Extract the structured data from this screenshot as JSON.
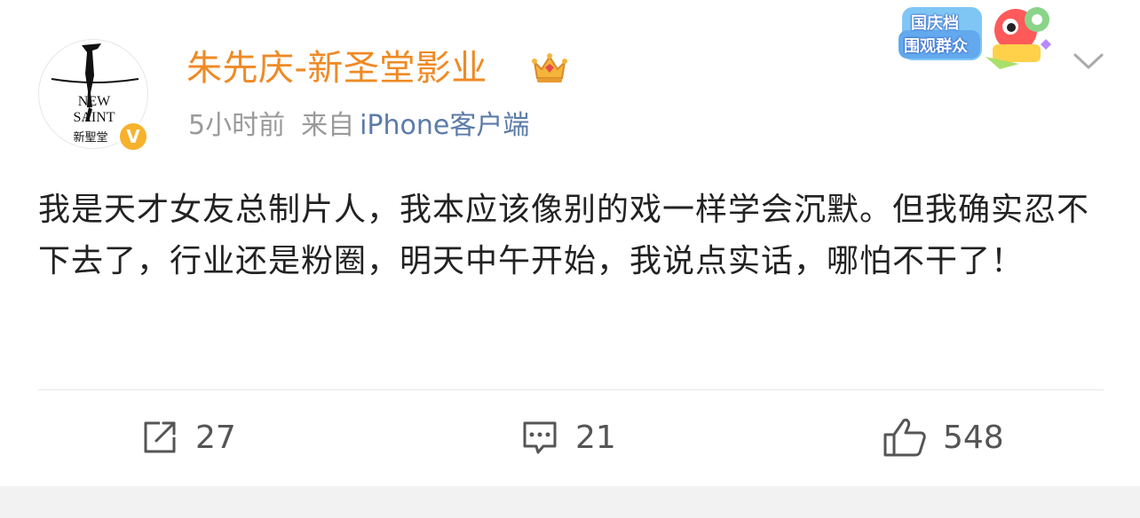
{
  "post": {
    "username": "朱先庆-新圣堂影业",
    "time": "5小时前",
    "source_label": "来自",
    "device": "iPhone客户端",
    "text": "我是天才女友总制片人，我本应该像别的戏一样学会沉默。但我确实忍不下去了，行业还是粉圈，明天中午开始，我说点实话，哪怕不干了！"
  },
  "avatar": {
    "logo_line1": "NEW",
    "logo_line2": "SAINT",
    "logo_line3": "新聖堂",
    "badge": "V"
  },
  "sticker": {
    "line1": "国庆档",
    "line2": "围观群众"
  },
  "actions": {
    "repost_count": "27",
    "comment_count": "21",
    "like_count": "548"
  },
  "colors": {
    "username": "#ef8a25",
    "device_link": "#5b7ba9",
    "meta": "#9a9a9a",
    "badge": "#f7b22c"
  },
  "icons": [
    "crown-icon",
    "chevron-down-icon",
    "repost-icon",
    "comment-icon",
    "like-icon",
    "verified-badge-icon"
  ]
}
